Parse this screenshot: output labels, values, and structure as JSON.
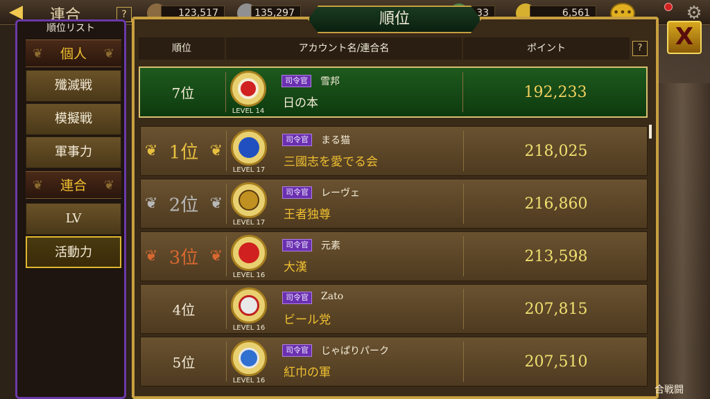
{
  "topbar": {
    "back_icon": "back-arrow-icon",
    "title": "連合",
    "help_label": "?",
    "resources": [
      {
        "name": "resource-1",
        "value": "123,517",
        "color": "#8a6a40"
      },
      {
        "name": "resource-2",
        "value": "135,297",
        "color": "#909090"
      },
      {
        "name": "resource-3",
        "value": "33",
        "color": "#4a8a4a"
      },
      {
        "name": "resource-4",
        "value": "6,561",
        "color": "#d8b030"
      }
    ],
    "chat_label": "•••"
  },
  "side": {
    "title": "順位リスト",
    "headers": [
      "個人",
      "連合"
    ],
    "items": [
      {
        "label": "殲滅戦"
      },
      {
        "label": "模擬戦"
      },
      {
        "label": "軍事力"
      },
      {
        "label": "LV"
      },
      {
        "label": "活動力"
      }
    ]
  },
  "panel": {
    "title": "順位",
    "columns": {
      "rank": "順位",
      "account": "アカウント名/連合名",
      "points": "ポイント"
    },
    "help_label": "?",
    "my_row": {
      "rank": "7位",
      "role": "司令官",
      "account": "雪邦",
      "alliance": "日の本",
      "level": "14",
      "points": "192,233",
      "emblem_color": "#d02020"
    },
    "rows": [
      {
        "rank": "1位",
        "tier": "gold",
        "role": "司令官",
        "account": "まる猫",
        "alliance": "三國志を愛でる会",
        "level": "17",
        "points": "218,025",
        "emblem_color": "#2050c0"
      },
      {
        "rank": "2位",
        "tier": "silver",
        "role": "司令官",
        "account": "レーヴェ",
        "alliance": "王者独尊",
        "level": "17",
        "points": "216,860",
        "emblem_color": "#c09020"
      },
      {
        "rank": "3位",
        "tier": "bronze",
        "role": "司令官",
        "account": "元素",
        "alliance": "大漢",
        "level": "16",
        "points": "213,598",
        "emblem_color": "#d02020"
      },
      {
        "rank": "4位",
        "tier": "normal",
        "role": "司令官",
        "account": "Zato",
        "alliance": "ビール党",
        "level": "16",
        "points": "207,815",
        "emblem_color": "#e8e8e8"
      },
      {
        "rank": "5位",
        "tier": "normal",
        "role": "司令官",
        "account": "じゃぱりパーク",
        "alliance": "紅巾の軍",
        "level": "16",
        "points": "207,510",
        "emblem_color": "#3070d0"
      }
    ],
    "level_prefix": "LEVEL"
  },
  "close_label": "X",
  "corner_label": "合戦闘"
}
